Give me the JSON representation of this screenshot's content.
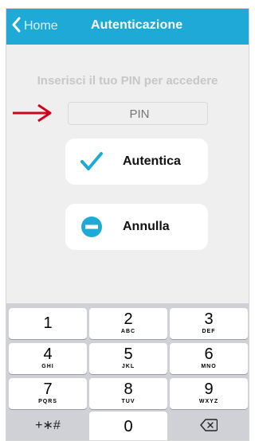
{
  "navbar": {
    "back_label": "Home",
    "title": "Autenticazione"
  },
  "main": {
    "prompt": "Inserisci il tuo PIN per accedere",
    "pin_placeholder": "PIN",
    "authenticate_label": "Autentica",
    "cancel_label": "Annulla"
  },
  "keyboard": {
    "keys": [
      {
        "num": "1",
        "letters": ""
      },
      {
        "num": "2",
        "letters": "ABC"
      },
      {
        "num": "3",
        "letters": "DEF"
      },
      {
        "num": "4",
        "letters": "GHI"
      },
      {
        "num": "5",
        "letters": "JKL"
      },
      {
        "num": "6",
        "letters": "MNO"
      },
      {
        "num": "7",
        "letters": "PQRS"
      },
      {
        "num": "8",
        "letters": "TUV"
      },
      {
        "num": "9",
        "letters": "WXYZ"
      },
      {
        "num": "+∗#",
        "letters": ""
      },
      {
        "num": "0",
        "letters": ""
      }
    ]
  },
  "colors": {
    "navbar": "#1fa9d6",
    "check": "#1fa9d6",
    "arrow": "#d0021b"
  },
  "icons": [
    "chevron-left-icon",
    "checkmark-icon",
    "minus-circle-icon",
    "backspace-icon",
    "red-arrow-icon"
  ]
}
